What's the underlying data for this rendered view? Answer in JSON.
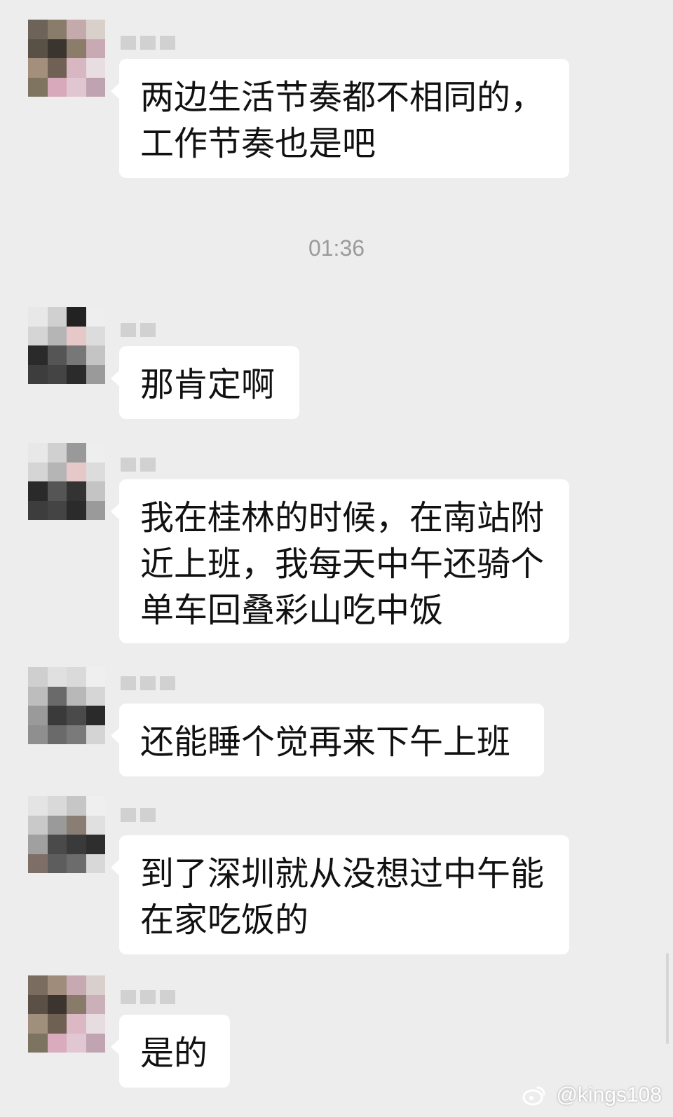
{
  "timestamp": "01:36",
  "messages": [
    {
      "text": "两边生活节奏都不相同的，\n工作节奏也是吧"
    },
    {
      "text": "那肯定啊"
    },
    {
      "text": "我在桂林的时候，在南站附\n近上班，我每天中午还骑个\n单车回叠彩山吃中饭"
    },
    {
      "text": "还能睡个觉再来下午上班"
    },
    {
      "text": "到了深圳就从没想过中午能\n在家吃饭的"
    },
    {
      "text": "是的"
    }
  ],
  "watermark": {
    "handle": "@kings108",
    "icon": "weibo-logo-icon"
  },
  "colors": {
    "background": "#ededed",
    "bubble": "#ffffff",
    "text": "#111111",
    "timestamp": "#9a9a9a"
  }
}
